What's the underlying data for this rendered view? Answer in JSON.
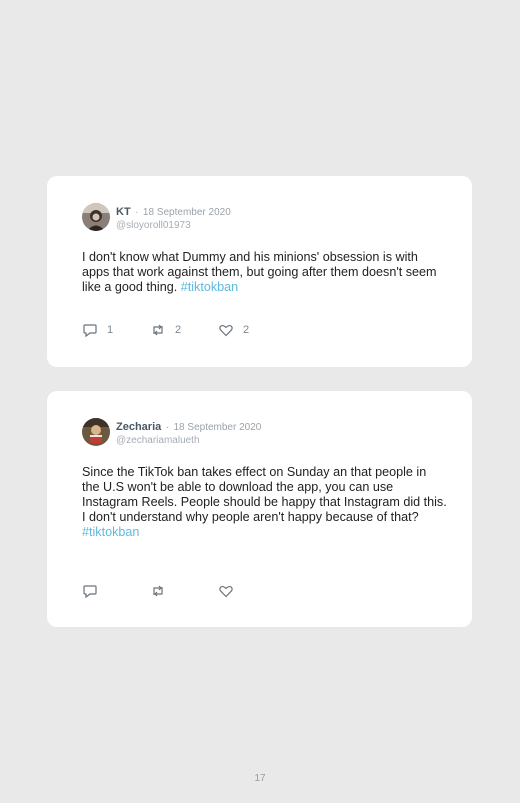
{
  "tweets": [
    {
      "name": "KT",
      "date": "18 September 2020",
      "handle": "@sloyoroll01973",
      "text": "I don't know what Dummy and his minions' obsession is with apps that work against them, but going after them doesn't seem like a good thing.",
      "hashtag": "#tiktokban",
      "replies": "1",
      "retweets": "2",
      "likes": "2"
    },
    {
      "name": "Zecharia",
      "date": "18 September 2020",
      "handle": "@zechariamalueth",
      "text": "Since the TikTok ban takes effect on Sunday an that people in the U.S won't be able to download the app, you can use Instagram Reels. People should be happy that Instagram did this. I don't understand why people aren't happy because of that?",
      "hashtag": "#tiktokban",
      "replies": "",
      "retweets": "",
      "likes": ""
    }
  ],
  "page_number": "17",
  "colors": {
    "background": "#e9e9e9",
    "hashtag": "#5fb8de",
    "name": "#4a5866"
  },
  "icons": [
    "reply-icon",
    "retweet-icon",
    "like-icon"
  ]
}
